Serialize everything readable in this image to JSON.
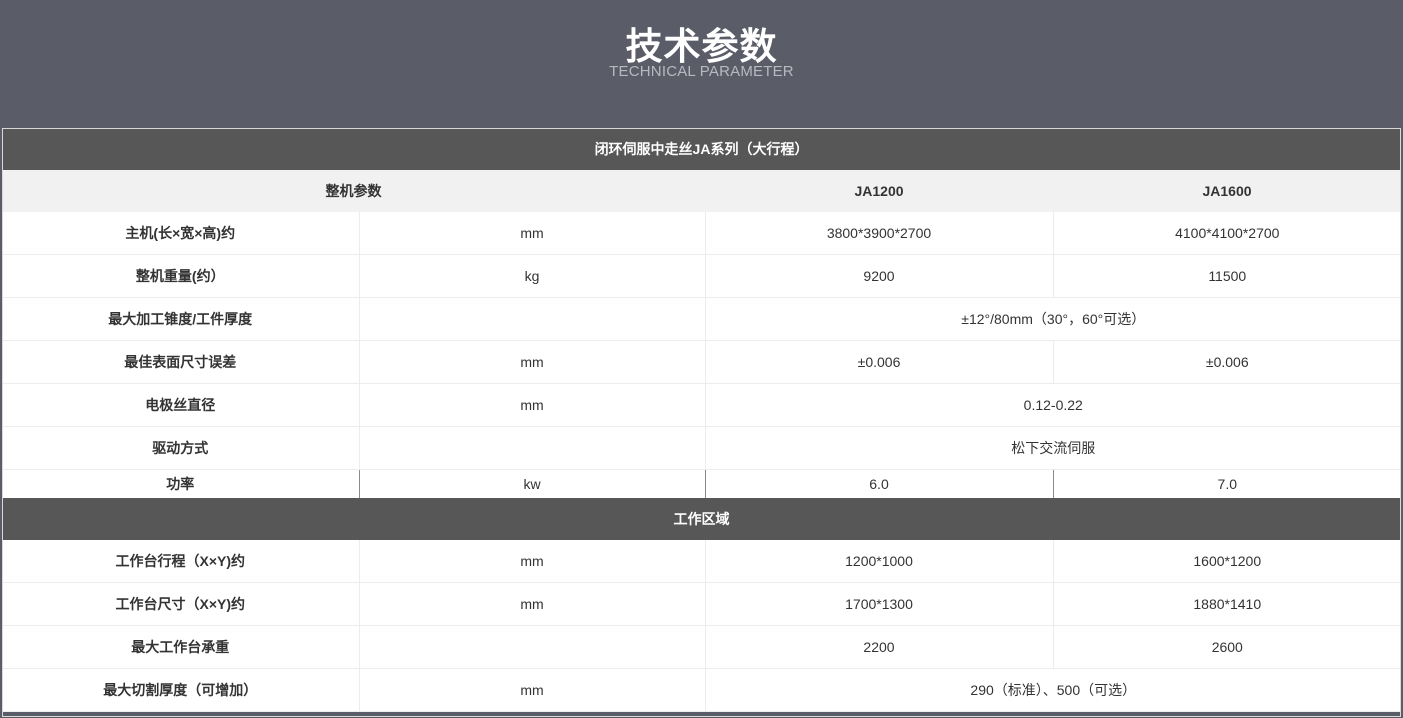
{
  "header": {
    "title": "技术参数",
    "subtitle": "TECHNICAL PARAMETER"
  },
  "table": {
    "section1_title": "闭环伺服中走丝JA系列（大行程）",
    "head": {
      "label": "整机参数",
      "col1": "JA1200",
      "col2": "JA1600"
    },
    "rows1": [
      {
        "label": "主机(长×宽×高)约",
        "unit": "mm",
        "v1": "3800*3900*2700",
        "v2": "4100*4100*2700"
      },
      {
        "label": "整机重量(约）",
        "unit": "kg",
        "v1": "9200",
        "v2": "11500"
      },
      {
        "label": "最大加工锥度/工件厚度",
        "unit": "",
        "merged": "±12°/80mm（30°，60°可选）"
      },
      {
        "label": "最佳表面尺寸误差",
        "unit": "mm",
        "v1": "±0.006",
        "v2": "±0.006"
      },
      {
        "label": "电极丝直径",
        "unit": "mm",
        "merged": "0.12-0.22"
      },
      {
        "label": "驱动方式",
        "unit": "",
        "merged": "松下交流伺服"
      },
      {
        "label": "功率",
        "unit": "kw",
        "v1": "6.0",
        "v2": "7.0"
      }
    ],
    "section2_title": "工作区域",
    "rows2": [
      {
        "label": "工作台行程（X×Y)约",
        "unit": "mm",
        "v1": "1200*1000",
        "v2": "1600*1200"
      },
      {
        "label": "工作台尺寸（X×Y)约",
        "unit": "mm",
        "v1": "1700*1300",
        "v2": "1880*1410"
      },
      {
        "label": "最大工作台承重",
        "unit": "",
        "v1": "2200",
        "v2": "2600"
      },
      {
        "label": "最大切割厚度（可增加）",
        "unit": "mm",
        "merged": "290（标准）、500（可选）"
      }
    ]
  }
}
